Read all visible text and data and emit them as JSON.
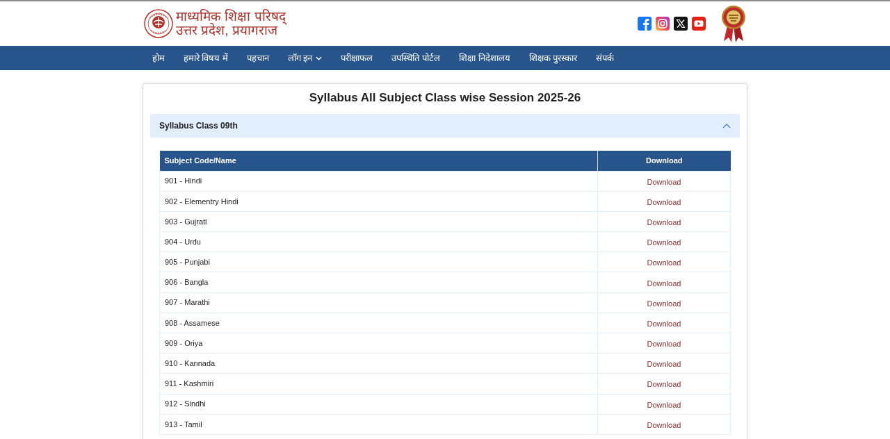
{
  "header": {
    "logo_lines": [
      "माध्यमिक शिक्षा परिषद्",
      "उत्तर प्रदेश, प्रयागराज"
    ]
  },
  "nav": {
    "items": [
      {
        "label": "होम",
        "has_dropdown": false
      },
      {
        "label": "हमारे विषय में",
        "has_dropdown": false
      },
      {
        "label": "पहचान",
        "has_dropdown": false
      },
      {
        "label": "लॉग इन",
        "has_dropdown": true
      },
      {
        "label": "परीक्षाफल",
        "has_dropdown": false
      },
      {
        "label": "उपस्थिति पोर्टल",
        "has_dropdown": false
      },
      {
        "label": "शिक्षा निदेशालय",
        "has_dropdown": false
      },
      {
        "label": "शिक्षक पुरस्कार",
        "has_dropdown": false
      },
      {
        "label": "संपर्क",
        "has_dropdown": false
      }
    ]
  },
  "card": {
    "title": "Syllabus All Subject Class wise Session 2025-26",
    "accordion": {
      "title": "Syllabus Class 09th",
      "expanded": true,
      "table": {
        "columns": [
          "Subject Code/Name",
          "Download"
        ],
        "rows": [
          {
            "subject": "901 - Hindi",
            "download": "Download"
          },
          {
            "subject": "902 - Elementry Hindi",
            "download": "Download"
          },
          {
            "subject": "903 - Gujrati",
            "download": "Download"
          },
          {
            "subject": "904 - Urdu",
            "download": "Download"
          },
          {
            "subject": "905 - Punjabi",
            "download": "Download"
          },
          {
            "subject": "906 - Bangla",
            "download": "Download"
          },
          {
            "subject": "907 - Marathi",
            "download": "Download"
          },
          {
            "subject": "908 - Assamese",
            "download": "Download"
          },
          {
            "subject": "909 - Oriya",
            "download": "Download"
          },
          {
            "subject": "910 - Kannada",
            "download": "Download"
          },
          {
            "subject": "911 - Kashmiri",
            "download": "Download"
          },
          {
            "subject": "912 - Sindhi",
            "download": "Download"
          },
          {
            "subject": "913 - Tamil",
            "download": "Download"
          }
        ]
      }
    }
  }
}
